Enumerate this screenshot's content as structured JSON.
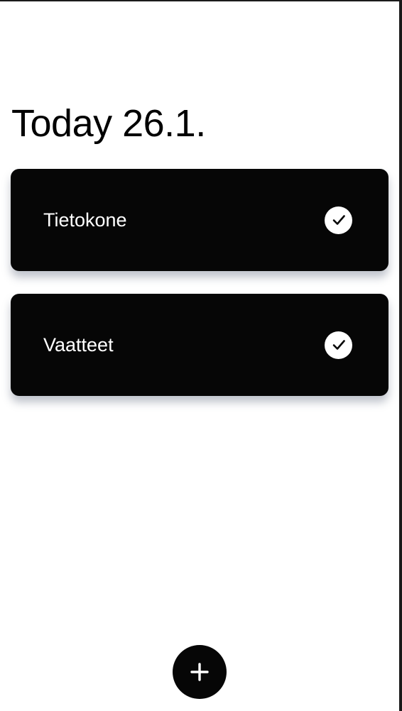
{
  "header": {
    "title": "Today 26.1."
  },
  "tasks": [
    {
      "label": "Tietokone",
      "status_icon": "check-circle-icon",
      "done": true
    },
    {
      "label": "Vaatteet",
      "status_icon": "check-circle-icon",
      "done": true
    }
  ],
  "fab": {
    "icon": "plus-icon"
  },
  "colors": {
    "background": "#ffffff",
    "card": "#060606",
    "card_text": "#ffffff",
    "accent": "#060606"
  }
}
